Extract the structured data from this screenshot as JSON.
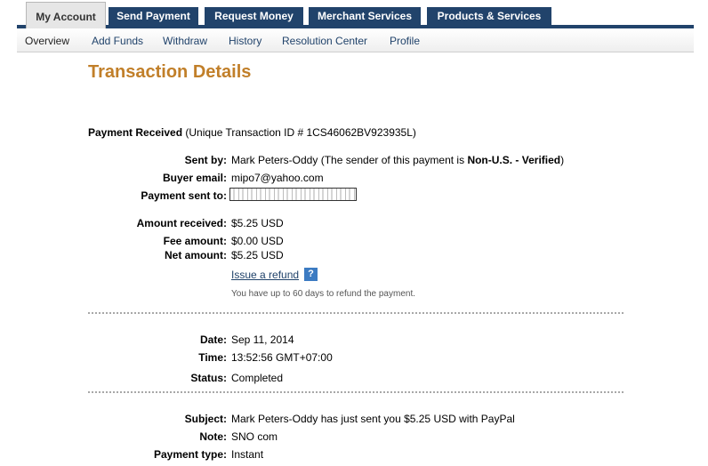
{
  "tabs": [
    "My Account",
    "Send Payment",
    "Request Money",
    "Merchant Services",
    "Products & Services"
  ],
  "subnav": [
    "Overview",
    "Add Funds",
    "Withdraw",
    "History",
    "Resolution Center",
    "Profile"
  ],
  "title": "Transaction Details",
  "intro": {
    "label": "Payment Received",
    "detail": " (Unique Transaction ID # 1CS46062BV923935L)"
  },
  "sender": {
    "sent_by_label": "Sent by:",
    "name": "Mark Peters-Oddy",
    "status_prefix": " (The sender of this payment is ",
    "status": "Non-U.S. - Verified",
    "status_suffix": ")",
    "buyer_email_label": "Buyer email:",
    "buyer_email": "mipo7@yahoo.com",
    "sent_to_label": "Payment sent to:"
  },
  "amounts": {
    "received_label": "Amount received:",
    "received": "$5.25 USD",
    "fee_label": "Fee amount:",
    "fee": "$0.00 USD",
    "net_label": "Net amount:",
    "net": "$5.25 USD"
  },
  "refund": {
    "link": "Issue a refund",
    "help": "?",
    "note": "You have up to 60 days to refund the payment."
  },
  "timing": {
    "date_label": "Date:",
    "date": "Sep 11, 2014",
    "time_label": "Time:",
    "time": "13:52:56 GMT+07:00",
    "status_label": "Status:",
    "status": "Completed"
  },
  "message": {
    "subject_label": "Subject:",
    "subject": "Mark Peters-Oddy has just sent you $5.25 USD with PayPal",
    "note_label": "Note:",
    "note": "SNO com",
    "type_label": "Payment type:",
    "type": "Instant"
  }
}
